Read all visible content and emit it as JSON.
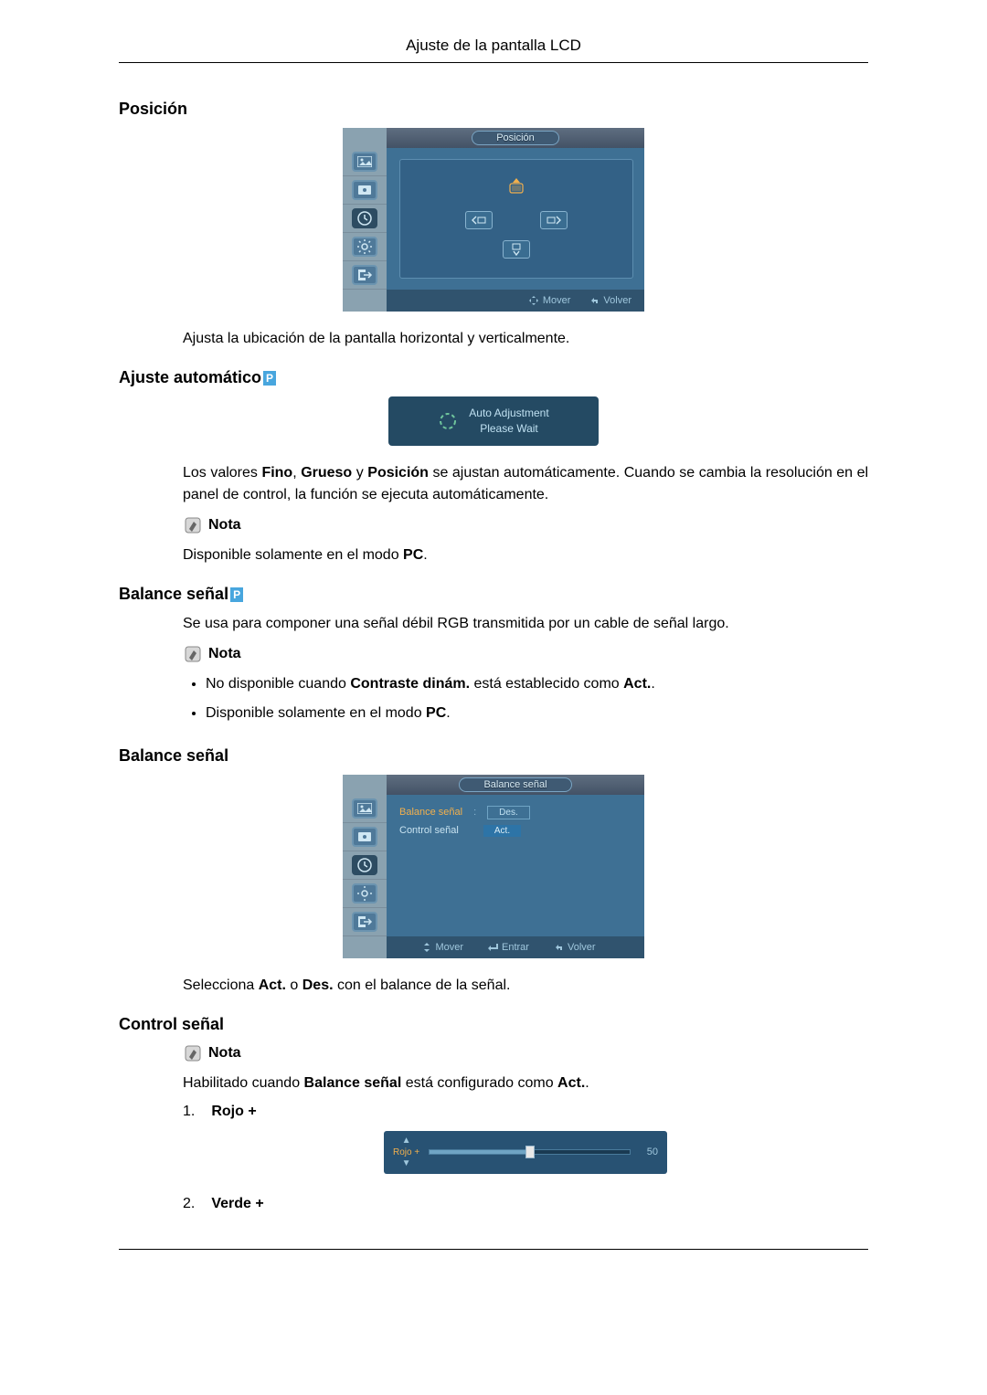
{
  "header": {
    "title": "Ajuste de la pantalla LCD"
  },
  "sections": {
    "posicion": {
      "heading": "Posición",
      "osd_title": "Posición",
      "footer": {
        "mover": "Mover",
        "volver": "Volver"
      },
      "description": "Ajusta la ubicación de la pantalla horizontal y verticalmente."
    },
    "ajuste_auto": {
      "heading": "Ajuste automático",
      "badge": "P",
      "dialog_line1": "Auto Adjustment",
      "dialog_line2": "Please Wait",
      "paragraph_prefix": "Los valores ",
      "fino": "Fino",
      "comma1": ", ",
      "grueso": "Grueso",
      "and": " y ",
      "posicion": "Posición",
      "paragraph_suffix": " se ajustan automáticamente. Cuando se cambia la resolución en el panel de control, la función se ejecuta automáticamente.",
      "nota_label": "Nota",
      "nota_body_prefix": "Disponible solamente en el modo ",
      "pc": "PC",
      "nota_body_suffix": "."
    },
    "balance1": {
      "heading": "Balance señal",
      "badge": "P",
      "description": "Se usa para componer una señal débil RGB transmitida por un cable de señal largo.",
      "nota_label": "Nota",
      "bullet1_prefix": "No disponible cuando ",
      "bullet1_bold": "Contraste dinám.",
      "bullet1_mid": " está establecido como ",
      "bullet1_bold2": "Act.",
      "bullet1_suffix": ".",
      "bullet2_prefix": "Disponible solamente en el modo ",
      "bullet2_bold": "PC",
      "bullet2_suffix": "."
    },
    "balance2": {
      "heading": "Balance señal",
      "osd_title": "Balance señal",
      "menu_item1": "Balance señal",
      "menu_item2": "Control señal",
      "val_des": "Des.",
      "val_act": "Act.",
      "footer": {
        "mover": "Mover",
        "entrar": "Entrar",
        "volver": "Volver"
      },
      "desc_prefix": "Selecciona ",
      "desc_act": "Act.",
      "desc_mid": " o ",
      "desc_des": "Des.",
      "desc_suffix": " con el balance de la señal."
    },
    "control": {
      "heading": "Control señal",
      "nota_label": "Nota",
      "desc_prefix": "Habilitado cuando ",
      "desc_bold1": "Balance señal",
      "desc_mid": " está configurado como ",
      "desc_bold2": "Act.",
      "desc_suffix": ".",
      "item1_num": "1.",
      "item1_label": "Rojo +",
      "item2_num": "2.",
      "item2_label": "Verde +",
      "slider_label": "Rojo +",
      "slider_value": "50"
    }
  }
}
